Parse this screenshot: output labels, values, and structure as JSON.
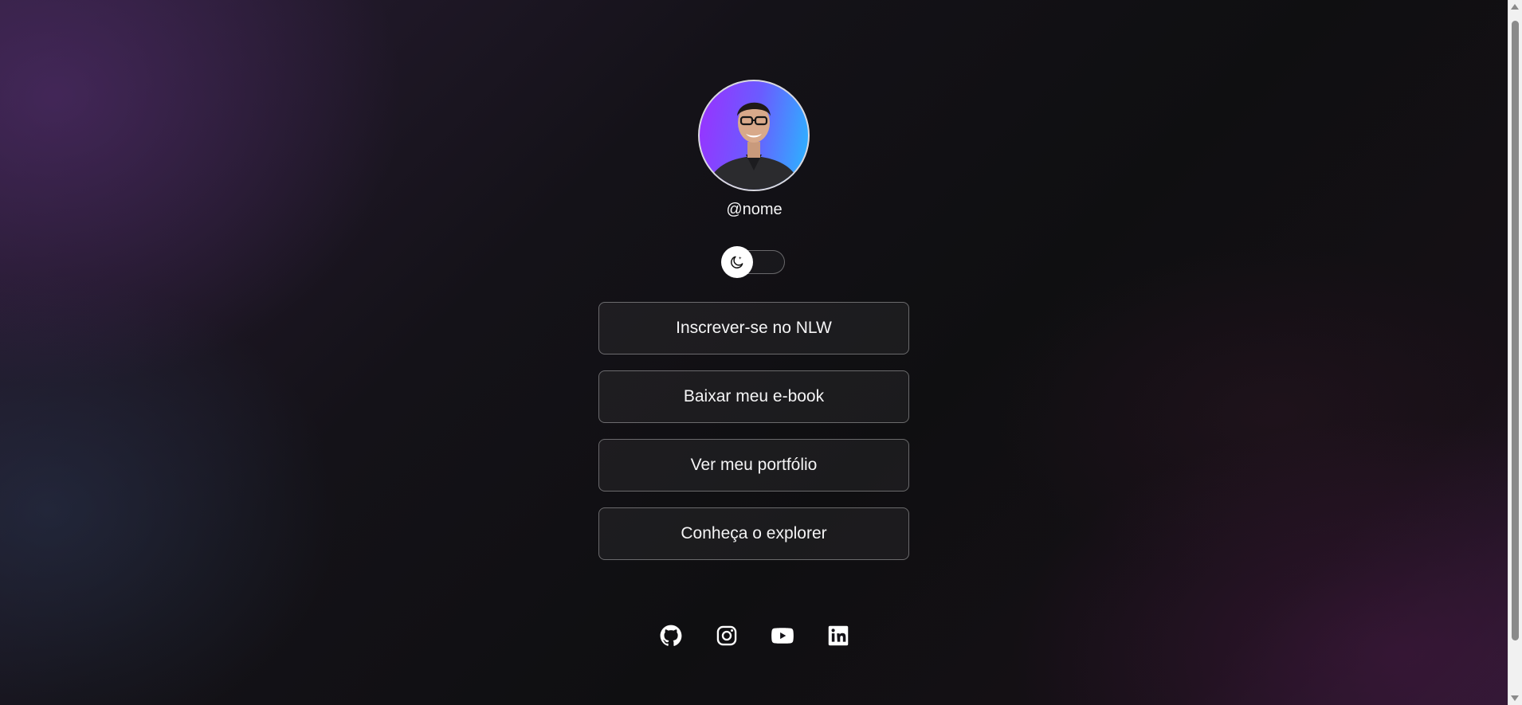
{
  "profile": {
    "username": "@nome",
    "avatar_alt": "avatar"
  },
  "theme_switch": {
    "icon": "moon-icon",
    "state": "dark"
  },
  "links": [
    {
      "label": "Inscrever-se no NLW"
    },
    {
      "label": "Baixar meu e-book"
    },
    {
      "label": "Ver meu portfólio"
    },
    {
      "label": "Conheça o explorer"
    }
  ],
  "social": [
    {
      "icon": "github-icon"
    },
    {
      "icon": "instagram-icon"
    },
    {
      "icon": "youtube-icon"
    },
    {
      "icon": "linkedin-icon"
    }
  ],
  "colors": {
    "text": "#f4f4f5",
    "accent_purple": "#9b30ff",
    "accent_blue": "#28b9ff",
    "button_border": "rgba(255,255,255,0.35)"
  }
}
